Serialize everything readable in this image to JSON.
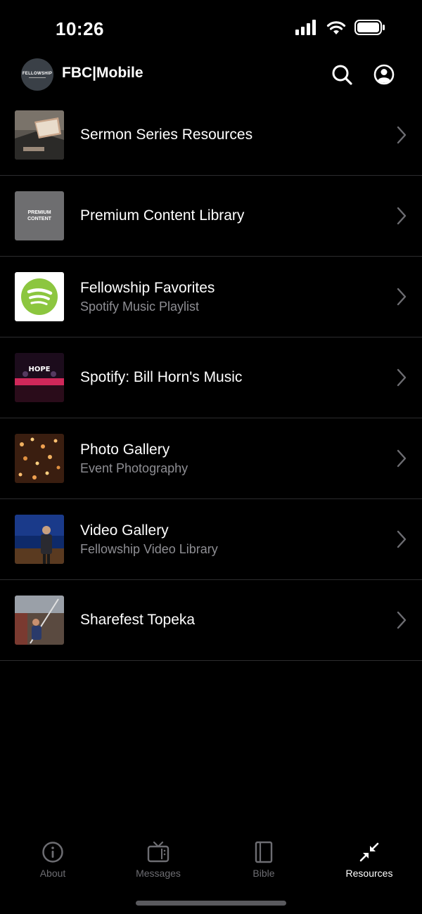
{
  "status": {
    "time": "10:26"
  },
  "header": {
    "logo_text": "FELLOWSHIP",
    "title": "FBC|Mobile"
  },
  "resources": [
    {
      "title": "Sermon Series Resources",
      "subtitle": ""
    },
    {
      "title": "Premium Content Library",
      "subtitle": "",
      "thumb_text": "PREMIUM CONTENT"
    },
    {
      "title": "Fellowship Favorites",
      "subtitle": "Spotify Music Playlist"
    },
    {
      "title": "Spotify: Bill Horn's Music",
      "subtitle": "",
      "thumb_text": "HOPE"
    },
    {
      "title": "Photo Gallery",
      "subtitle": "Event Photography"
    },
    {
      "title": "Video Gallery",
      "subtitle": "Fellowship Video Library"
    },
    {
      "title": "Sharefest Topeka",
      "subtitle": ""
    }
  ],
  "tabs": [
    {
      "label": "About",
      "icon": "info-icon"
    },
    {
      "label": "Messages",
      "icon": "tv-icon"
    },
    {
      "label": "Bible",
      "icon": "book-icon"
    },
    {
      "label": "Resources",
      "icon": "collapse-arrows-icon",
      "active": true
    }
  ],
  "colors": {
    "background": "#000000",
    "separator": "#2c2c2e",
    "subtitle": "#8e8e93",
    "tab_inactive": "#6d6d72",
    "spotify_green": "#8cc63f"
  }
}
